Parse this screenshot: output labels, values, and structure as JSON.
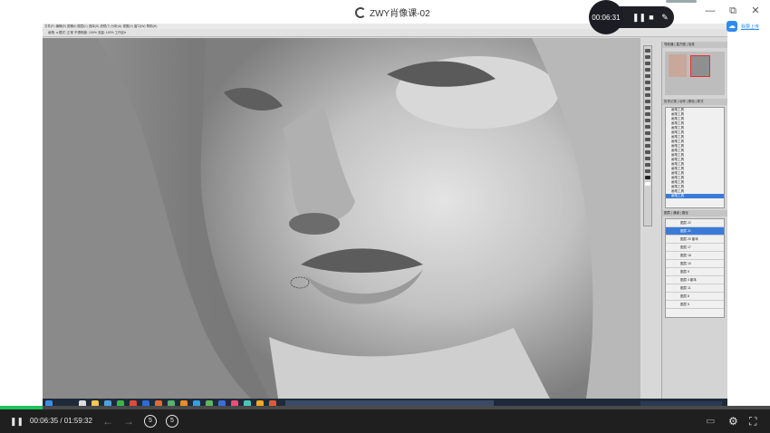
{
  "window": {
    "title": "ZWY肖像课-02",
    "minimize": "—",
    "restore": "⧉",
    "close": "✕"
  },
  "recorder": {
    "elapsed": "00:06:31",
    "pause": "❚❚",
    "stop": "■",
    "pen": "✎"
  },
  "upload": {
    "label": "我要上传",
    "icon": "cloud-upload-icon"
  },
  "photoshop": {
    "menu_text": "文件(F) 编辑(E) 图像(I) 图层(L) 选择(S) 滤镜(T) 分析(A) 视图(V) 窗口(W) 帮助(H)",
    "options_text": "画笔: ● 模式: 正常   不透明度: 100%   流量: 100%   工作区▾",
    "navigator_tabs": "导航器 | 直方图 | 信息",
    "history_tabs": "历史记录 | 动作 | 颜色 | 样式",
    "layer_tabs": "图层 | 通道 | 路径",
    "history_items": [
      "画笔工具",
      "画笔工具",
      "画笔工具",
      "画笔工具",
      "画笔工具",
      "画笔工具",
      "画笔工具",
      "画笔工具",
      "画笔工具",
      "画笔工具",
      "画笔工具",
      "画笔工具",
      "画笔工具",
      "画笔工具",
      "画笔工具",
      "画笔工具",
      "画笔工具",
      "画笔工具",
      "画笔工具",
      "画笔工具"
    ],
    "layer_items": [
      "图层 22",
      "图层 21",
      "图层 20 副本",
      "图层 17",
      "图层 18",
      "图层 10",
      "图层 9",
      "图层 4 副本",
      "图层 11",
      "图层 8",
      "图层 5"
    ]
  },
  "player": {
    "time_display": "00:06:35 / 01:59:32",
    "progress_fraction": 0.055,
    "play_pause": "❚❚",
    "prev": "←",
    "next": "→",
    "skip_back": "5",
    "skip_forward": "5",
    "subtitle": "▭",
    "settings": "⚙",
    "fullscreen": "⛶"
  },
  "colors": {
    "progress": "#1ec45a",
    "accent": "#2e8cf0",
    "selected_layer": "#3b7bd8"
  }
}
